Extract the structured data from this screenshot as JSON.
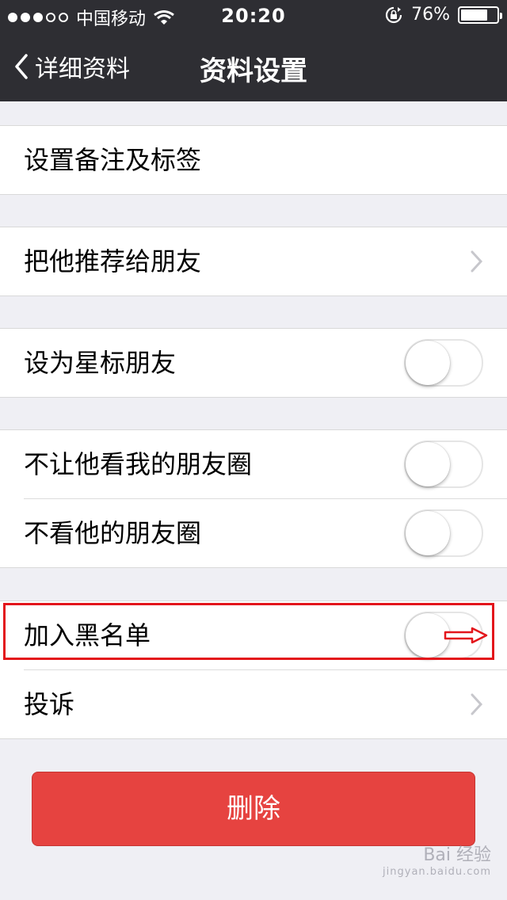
{
  "status_bar": {
    "carrier": "中国移动",
    "time": "20:20",
    "battery_percent": "76%",
    "battery_level": 0.76,
    "signal_bars_filled": 3,
    "signal_bars_total": 5
  },
  "nav": {
    "back_label": "详细资料",
    "title": "资料设置"
  },
  "groups": [
    {
      "rows": [
        {
          "label": "设置备注及标签",
          "control": "none"
        }
      ]
    },
    {
      "rows": [
        {
          "label": "把他推荐给朋友",
          "control": "chevron"
        }
      ]
    },
    {
      "rows": [
        {
          "label": "设为星标朋友",
          "control": "toggle",
          "on": false
        }
      ]
    },
    {
      "rows": [
        {
          "label": "不让他看我的朋友圈",
          "control": "toggle",
          "on": false
        },
        {
          "label": "不看他的朋友圈",
          "control": "toggle",
          "on": false
        }
      ]
    },
    {
      "rows": [
        {
          "label": "加入黑名单",
          "control": "toggle",
          "on": false
        },
        {
          "label": "投诉",
          "control": "chevron"
        }
      ]
    }
  ],
  "delete_button": {
    "label": "删除"
  },
  "colors": {
    "nav_bg": "#2e2e33",
    "page_bg": "#efeff4",
    "delete_bg": "#e64340",
    "highlight": "#e3151b"
  },
  "watermark": {
    "brand": "Bai 经验",
    "url": "jingyan.baidu.com"
  }
}
